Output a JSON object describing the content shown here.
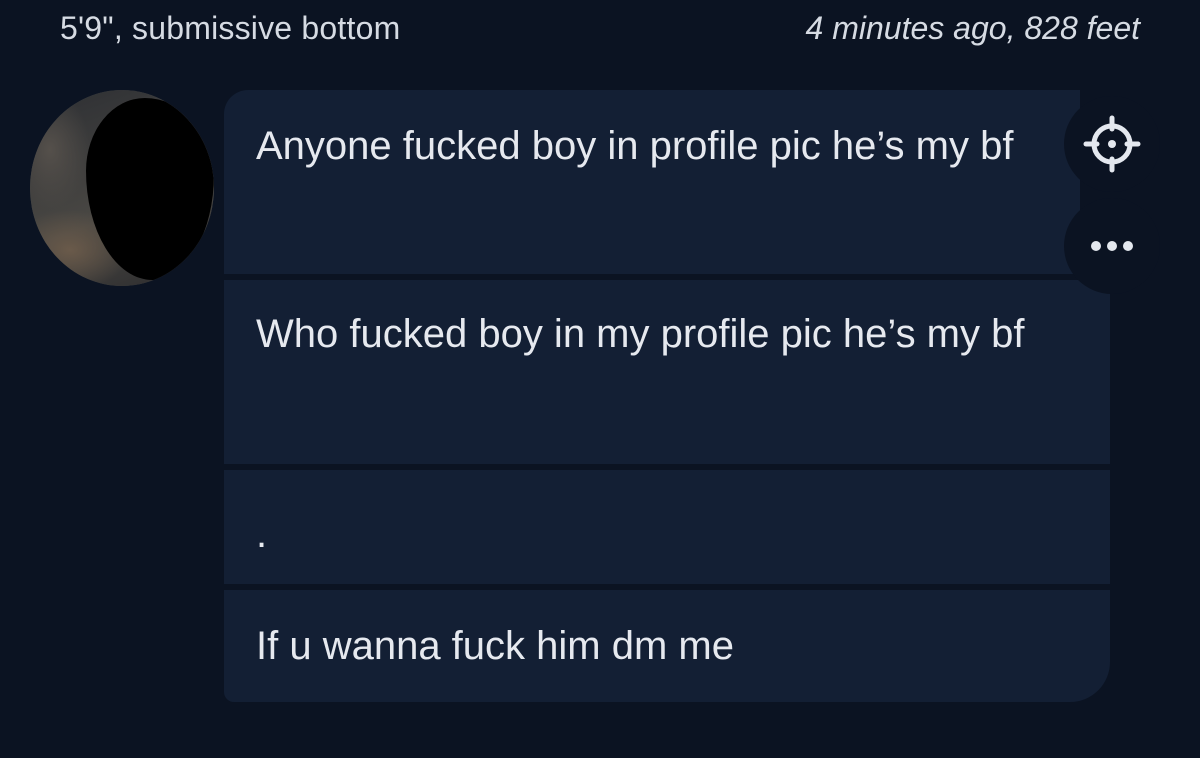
{
  "header": {
    "profile_summary": "5'9\", submissive bottom",
    "time_distance": "4 minutes ago, 828 feet"
  },
  "messages": [
    {
      "text": "Anyone fucked boy in profile pic he’s my bf"
    },
    {
      "text": "Who fucked boy in my profile pic he’s my bf"
    },
    {
      "text": "."
    },
    {
      "text": "If u wanna fuck him dm me"
    }
  ],
  "icons": {
    "locate": "crosshair-icon",
    "more": "more-options-icon"
  },
  "colors": {
    "background": "#0b1322",
    "bubble": "#131f34",
    "text": "#e6e9ef"
  }
}
